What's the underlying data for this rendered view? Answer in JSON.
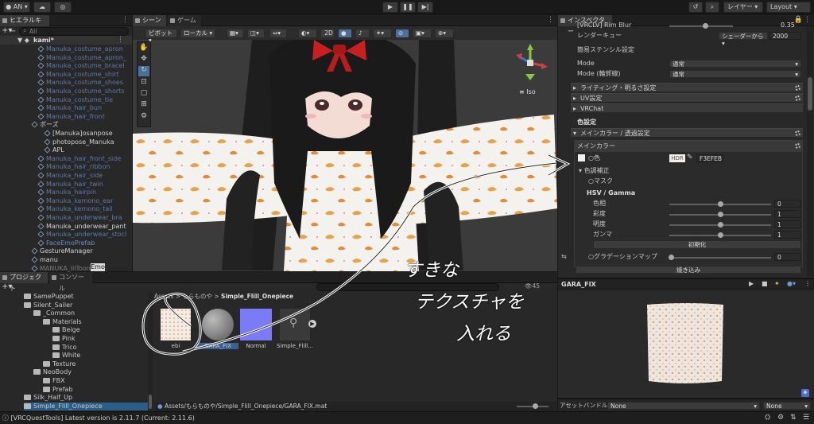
{
  "toolbar": {
    "account": "AN",
    "layers": "レイヤー",
    "layout": "Layout"
  },
  "hierarchy": {
    "tab": "ヒエラルキー",
    "search_placeholder": "All",
    "scene": "kami*",
    "rows": [
      {
        "label": "Manuka_costume_apron",
        "style": "prefab-dim",
        "indent": 48
      },
      {
        "label": "Manuka_costume_apron_",
        "style": "prefab-dim",
        "indent": 48
      },
      {
        "label": "Manuka_costume_bracel",
        "style": "prefab-dim",
        "indent": 48
      },
      {
        "label": "Manuka_costume_shirt",
        "style": "prefab-dim",
        "indent": 48
      },
      {
        "label": "Manuka_costume_shoes",
        "style": "prefab-dim",
        "indent": 48
      },
      {
        "label": "Manuka_costume_shorts",
        "style": "prefab-dim",
        "indent": 48
      },
      {
        "label": "Manuka_costume_tie",
        "style": "prefab-dim",
        "indent": 48
      },
      {
        "label": "Manuka_hair_bun",
        "style": "prefab-dim",
        "indent": 48
      },
      {
        "label": "Manuka_hair_front",
        "style": "prefab-dim",
        "indent": 48
      },
      {
        "label": "ポーズ",
        "style": "normal",
        "indent": 40
      },
      {
        "label": "[Manuka]osanpose",
        "style": "normal",
        "indent": 56
      },
      {
        "label": "photopose_Manuka",
        "style": "normal",
        "indent": 56
      },
      {
        "label": "APL",
        "style": "normal",
        "indent": 56
      },
      {
        "label": "Manuka_hair_front_side",
        "style": "prefab-dim",
        "indent": 48
      },
      {
        "label": "Manuka_hair_ribbon",
        "style": "prefab-dim",
        "indent": 48
      },
      {
        "label": "Manuka_hair_side",
        "style": "prefab-dim",
        "indent": 48
      },
      {
        "label": "Manuka_hair_twin",
        "style": "prefab-dim",
        "indent": 48
      },
      {
        "label": "Manuka_hairpin",
        "style": "prefab-dim",
        "indent": 48
      },
      {
        "label": "Manuka_kemono_ear",
        "style": "prefab-dim",
        "indent": 48
      },
      {
        "label": "Manuka_kemono_tail",
        "style": "prefab-dim",
        "indent": 48
      },
      {
        "label": "Manuka_underwear_bra",
        "style": "prefab-dim",
        "indent": 48
      },
      {
        "label": "Manuka_underwear_pant",
        "style": "normal",
        "indent": 48
      },
      {
        "label": "Manuka_underwear_stocl",
        "style": "prefab-dim",
        "indent": 48
      },
      {
        "label": "FaceEmoPrefab",
        "style": "prefab",
        "indent": 48
      },
      {
        "label": "GestureManager",
        "style": "normal",
        "indent": 40
      },
      {
        "label": "manu",
        "style": "normal",
        "indent": 40
      },
      {
        "label": "MANUKA_lilToon",
        "style": "dim",
        "indent": 40
      }
    ],
    "emo_tag": "Emo"
  },
  "scene": {
    "tab_scene": "シーン",
    "tab_game": "ゲーム",
    "pivot": "ピボット",
    "local": "ローカル",
    "mode_2d": "2D",
    "iso": "Iso"
  },
  "inspector": {
    "tab": "インスペクター",
    "rim_blur_label": "[VRCLV] Rim Blur",
    "rim_blur_value": "0.35",
    "render_queue_label": "レンダーキュー",
    "render_queue_mode": "シェーダーから",
    "render_queue_value": "2000",
    "stencil_title": "簡易ステンシル設定",
    "mode_label": "Mode",
    "mode_value": "通常",
    "mode_outline_label": "Mode (輪郭線)",
    "mode_outline_value": "通常",
    "section_lighting": "ライティング・明るさ設定",
    "section_uv": "UV設定",
    "section_vrchat": "VRChat",
    "color_settings": "色設定",
    "section_main": "メインカラー / 透過設定",
    "main_color": "メインカラー",
    "color_label": "色",
    "hdr": "HDR",
    "hex": "F3EFEB",
    "color_correction": "色調補正",
    "mask": "マスク",
    "hsv": "HSV / Gamma",
    "hue": "色相",
    "hue_val": "0",
    "saturation": "彩度",
    "saturation_val": "1",
    "brightness": "明度",
    "brightness_val": "1",
    "gamma": "ガンマ",
    "gamma_val": "1",
    "reset": "初期化",
    "gradient_map": "グラデーションマップ",
    "gradient_val": "0",
    "bake": "焼き込み",
    "preview_title": "GARA_FIX",
    "asset_bundle_label": "アセットバンドル",
    "asset_bundle_value": "None",
    "asset_bundle_variant": "None"
  },
  "project": {
    "tab_project": "プロジェクト",
    "tab_console": "コンソール",
    "breadcrumb_root": "Assets",
    "breadcrumb_mid": "もらものや",
    "breadcrumb_leaf": "Simple_Flill_Onepiece",
    "count": "45",
    "tree": [
      {
        "label": "SamePuppet",
        "indent": 30
      },
      {
        "label": "Silent_Sailer",
        "indent": 30
      },
      {
        "label": "_Common",
        "indent": 42
      },
      {
        "label": "Materials",
        "indent": 54
      },
      {
        "label": "Beige",
        "indent": 66
      },
      {
        "label": "Pink",
        "indent": 66
      },
      {
        "label": "Trico",
        "indent": 66
      },
      {
        "label": "White",
        "indent": 66
      },
      {
        "label": "Texture",
        "indent": 54
      },
      {
        "label": "NeoBody",
        "indent": 42
      },
      {
        "label": "FBX",
        "indent": 54
      },
      {
        "label": "Prefab",
        "indent": 54
      },
      {
        "label": "Silk_Half_Up",
        "indent": 30
      },
      {
        "label": "Simple_Flill_Onepiece",
        "indent": 30
      }
    ],
    "assets": [
      "ebi",
      "GARA_FIX",
      "Normal",
      "Simple_Flill..."
    ],
    "status_path": "Assets/もらものや/Simple_Flill_Onepiece/GARA_FIX.mat"
  },
  "annotation": {
    "line1": "すきな",
    "line2": "テクスチャを",
    "line3": "入れる"
  },
  "status_bar": {
    "message": "[VRCQuestTools] Latest version is 2.11.7 (Current: 2.11.6)"
  }
}
